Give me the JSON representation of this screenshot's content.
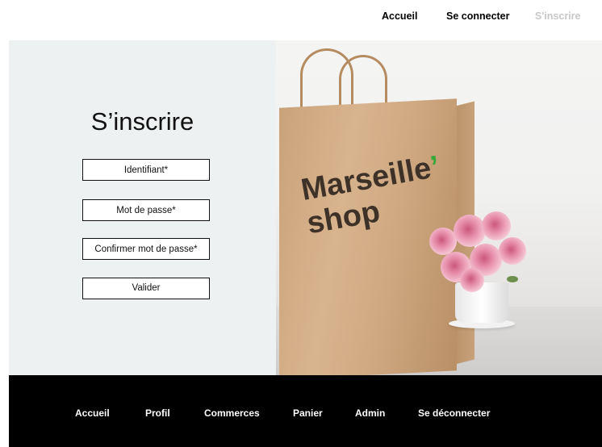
{
  "top_nav": {
    "items": [
      {
        "label": "Accueil",
        "active": true
      },
      {
        "label": "Se connecter",
        "active": true
      },
      {
        "label": "S'inscrire",
        "active": false
      }
    ]
  },
  "form": {
    "title": "S’inscrire",
    "username_placeholder": "Identifiant*",
    "password_placeholder": "Mot de passe*",
    "confirm_placeholder": "Confirmer mot de passe*",
    "submit_label": "Valider"
  },
  "hero": {
    "brand_line1": "Marseille",
    "brand_apostrophe": "’",
    "brand_line2": "shop"
  },
  "footer_nav": {
    "items": [
      "Accueil",
      "Profil",
      "Commerces",
      "Panier",
      "Admin",
      "Se déconnecter"
    ]
  },
  "colors": {
    "page_background": "#ffffff",
    "form_panel": "#eef1f1",
    "footer": "#000000",
    "inactive_link": "#c8c8c8",
    "brand_accent": "#3aa63a"
  }
}
